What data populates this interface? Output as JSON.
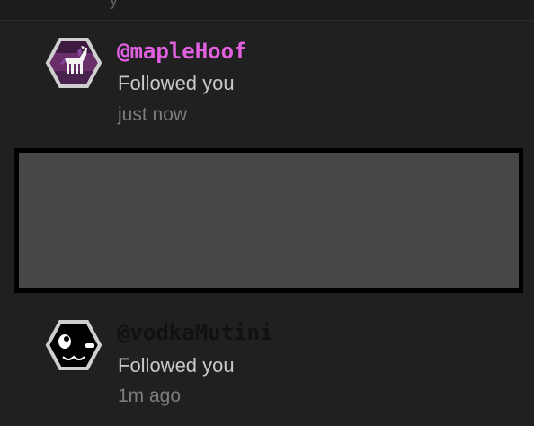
{
  "notifications": [
    {
      "handle": "@mapleHoof",
      "action": "Followed you",
      "time": "just now",
      "handle_color": "#e060e0",
      "avatar": "pony-avatar-icon"
    },
    {
      "handle": "@vodkaMutini",
      "action": "Followed you",
      "time": "1m ago",
      "handle_color": "#111111",
      "avatar": "cat-face-avatar-icon"
    }
  ],
  "colors": {
    "background": "#202020",
    "placeholder": "#474747",
    "placeholder_border": "#000000",
    "secondary_text": "#c9c9c9",
    "muted_text": "#7d7d7d"
  }
}
